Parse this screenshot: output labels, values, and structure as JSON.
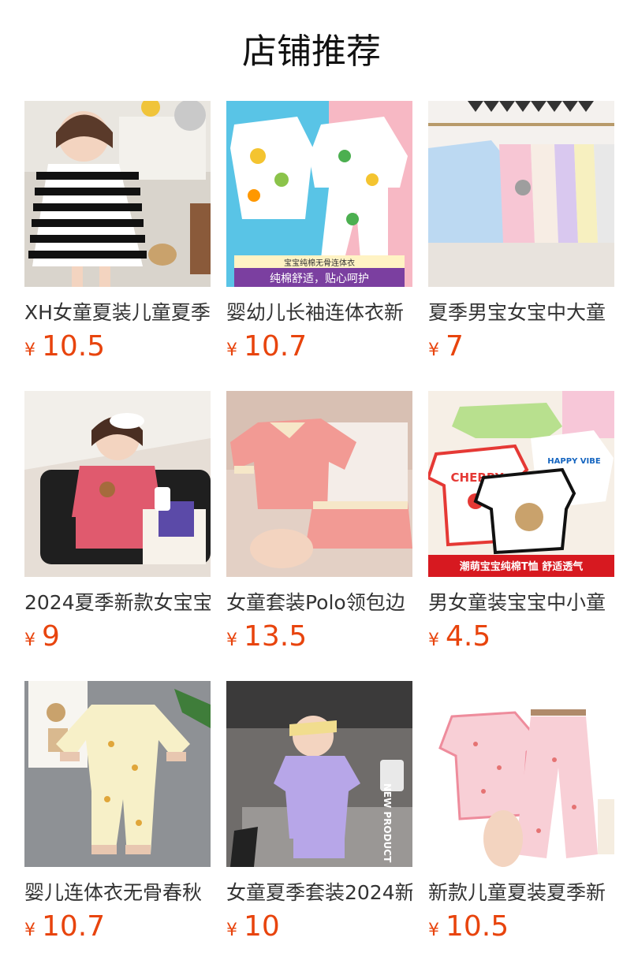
{
  "header": {
    "title": "店铺推荐"
  },
  "currency_symbol": "¥",
  "colors": {
    "price": "#e8440d",
    "text": "#333333"
  },
  "products": [
    {
      "name": "XH女童夏装儿童夏季",
      "price": "10.5",
      "image_icon": "striped-dress-image"
    },
    {
      "name": "婴幼儿长袖连体衣新",
      "price": "10.7",
      "image_icon": "baby-romper-image",
      "image_text": [
        "宝宝纯棉无骨连体衣",
        "纯棉舒适，贴心呵护"
      ]
    },
    {
      "name": "夏季男宝女宝中大童",
      "price": "7",
      "image_icon": "hoodie-rack-image"
    },
    {
      "name": "2024夏季新款女宝宝",
      "price": "9",
      "image_icon": "girl-pink-set-image"
    },
    {
      "name": "女童套装Polo领包边",
      "price": "13.5",
      "image_icon": "polo-set-image"
    },
    {
      "name": "男女童装宝宝中小童",
      "price": "4.5",
      "image_icon": "tshirts-image",
      "image_text": [
        "CHERRY",
        "HAPPY VIBE",
        "潮萌宝宝纯棉T恤 舒适透气"
      ]
    },
    {
      "name": "婴儿连体衣无骨春秋",
      "price": "10.7",
      "image_icon": "yellow-romper-image"
    },
    {
      "name": "女童夏季套装2024新",
      "price": "10",
      "image_icon": "girl-purple-set-image",
      "image_text": [
        "NEW PRODUCT"
      ]
    },
    {
      "name": "新款儿童夏装夏季新",
      "price": "10.5",
      "image_icon": "pink-pajamas-image"
    }
  ]
}
